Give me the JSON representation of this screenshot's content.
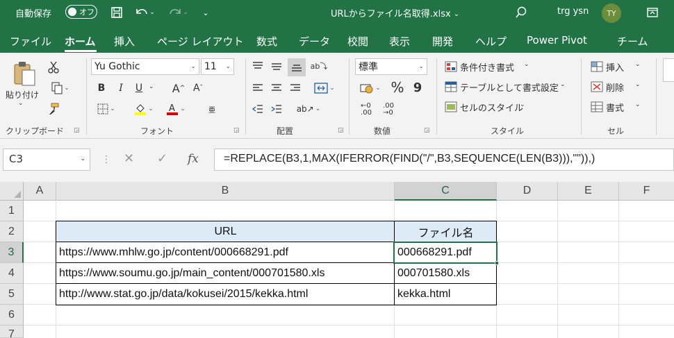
{
  "titlebar": {
    "autosave_label": "自動保存",
    "autosave_state": "オフ",
    "filename": "URLからファイル名取得.xlsx",
    "user_name": "trg ysn",
    "user_initials": "TY"
  },
  "ribbon_tabs": [
    "ファイル",
    "ホーム",
    "挿入",
    "ページ レイアウト",
    "数式",
    "データ",
    "校閲",
    "表示",
    "開発",
    "ヘルプ",
    "Power Pivot",
    "チーム"
  ],
  "ribbon": {
    "clipboard": {
      "paste_label": "貼り付け",
      "group_label": "クリップボード"
    },
    "font": {
      "font_name": "Yu Gothic",
      "font_size": "11",
      "bold": "B",
      "italic": "I",
      "underline": "U",
      "grow": "A",
      "shrink": "A",
      "group_label": "フォント"
    },
    "alignment": {
      "group_label": "配置"
    },
    "number": {
      "format": "標準",
      "percent": "%",
      "comma": "9",
      "group_label": "数値"
    },
    "styles": {
      "conditional": "条件付き書式",
      "table": "テーブルとして書式設定",
      "cell_styles": "セルのスタイル",
      "group_label": "スタイル"
    },
    "cells": {
      "insert": "挿入",
      "delete": "削除",
      "format": "書式",
      "group_label": "セル"
    }
  },
  "formula_bar": {
    "name_box": "C3",
    "fx": "fx",
    "formula": "=REPLACE(B3,1,MAX(IFERROR(FIND(\"/\",B3,SEQUENCE(LEN(B3))),\"\")),)"
  },
  "sheet": {
    "columns": [
      "A",
      "B",
      "C",
      "D",
      "E",
      "F"
    ],
    "rows": [
      "1",
      "2",
      "3",
      "4",
      "5",
      "6",
      "7"
    ],
    "active_cell": "C3",
    "table": {
      "headers": [
        "URL",
        "ファイル名"
      ],
      "rows": [
        [
          "https://www.mhlw.go.jp/content/000668291.pdf",
          "000668291.pdf"
        ],
        [
          "https://www.soumu.go.jp/main_content/000701580.xls",
          "000701580.xls"
        ],
        [
          "http://www.stat.go.jp/data/kokusei/2015/kekka.html",
          "kekka.html"
        ]
      ]
    }
  },
  "colors": {
    "excel_green": "#217346",
    "header_fill": "#ddebf7"
  }
}
